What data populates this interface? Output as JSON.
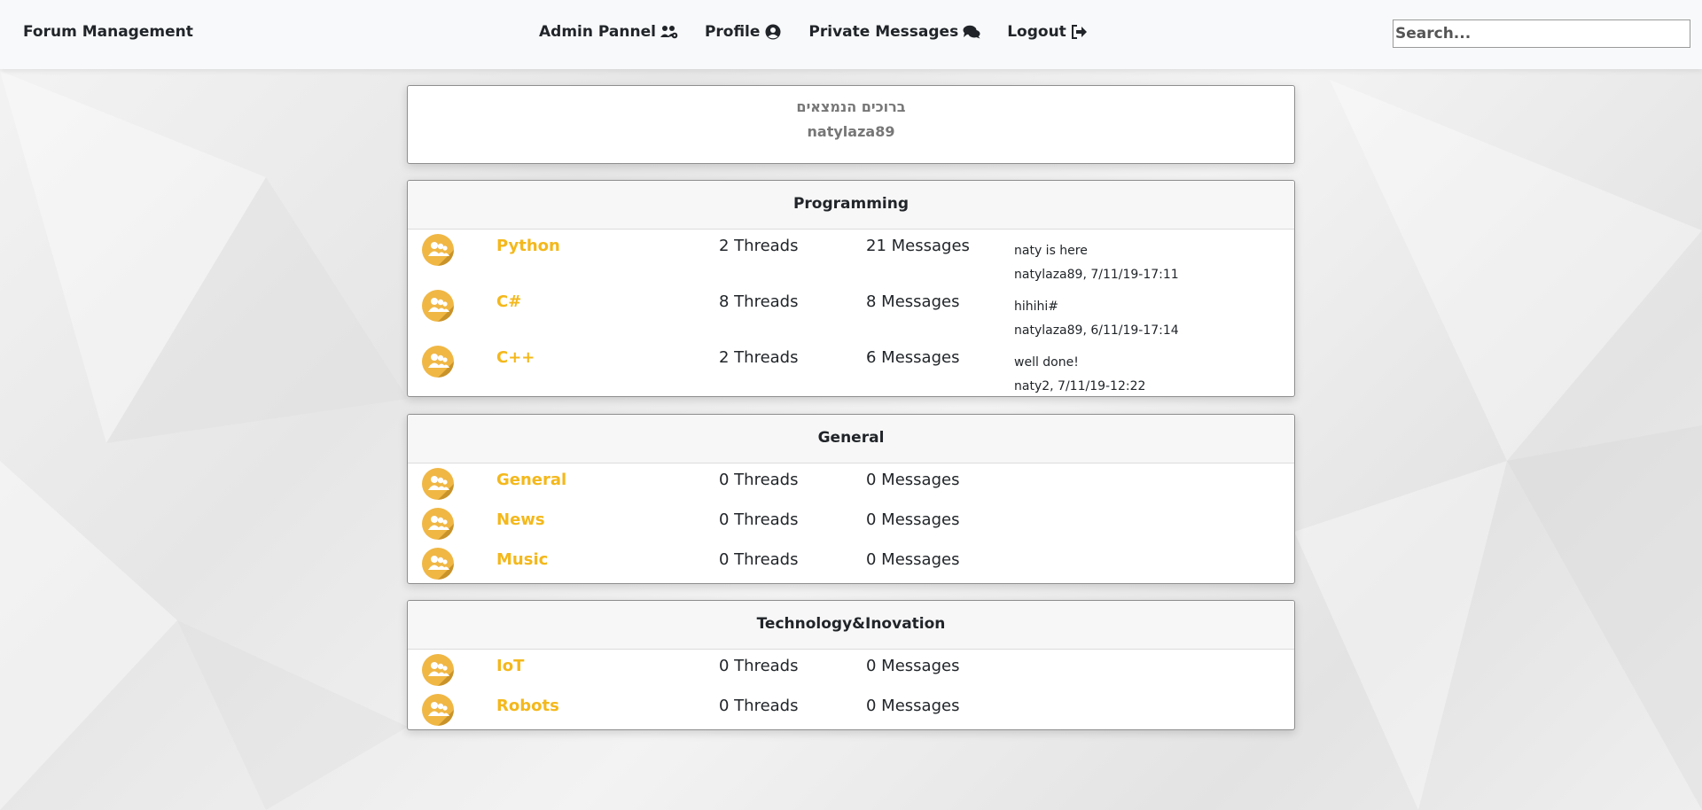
{
  "navbar": {
    "brand": "Forum Management",
    "links": [
      {
        "label": "Admin Pannel",
        "icon": "users-cog-icon"
      },
      {
        "label": "Profile",
        "icon": "user-circle-icon"
      },
      {
        "label": "Private Messages",
        "icon": "comments-icon"
      },
      {
        "label": "Logout",
        "icon": "sign-out-icon"
      }
    ],
    "search_placeholder": "Search..."
  },
  "welcome": {
    "greeting": "ברוכים הנמצאים",
    "username": "natylaza89"
  },
  "categories": [
    {
      "title": "Programming",
      "forums": [
        {
          "name": "Python",
          "threads": "2 Threads",
          "messages": "21 Messages",
          "last_text": "naty is here",
          "last_meta": "natylaza89, 7/11/19-17:11"
        },
        {
          "name": "C#",
          "threads": "8 Threads",
          "messages": "8 Messages",
          "last_text": "hihihi#",
          "last_meta": "natylaza89, 6/11/19-17:14"
        },
        {
          "name": "C++",
          "threads": "2 Threads",
          "messages": "6 Messages",
          "last_text": "well done!",
          "last_meta": "naty2, 7/11/19-12:22"
        }
      ]
    },
    {
      "title": "General",
      "forums": [
        {
          "name": "General",
          "threads": "0 Threads",
          "messages": "0 Messages"
        },
        {
          "name": "News",
          "threads": "0 Threads",
          "messages": "0 Messages"
        },
        {
          "name": "Music",
          "threads": "0 Threads",
          "messages": "0 Messages"
        }
      ]
    },
    {
      "title": "Technology&Inovation",
      "forums": [
        {
          "name": "IoT",
          "threads": "0 Threads",
          "messages": "0 Messages"
        },
        {
          "name": "Robots",
          "threads": "0 Threads",
          "messages": "0 Messages"
        }
      ]
    }
  ],
  "colors": {
    "forum_link": "#f4b81c",
    "avatar_bg": "#f0b744"
  }
}
